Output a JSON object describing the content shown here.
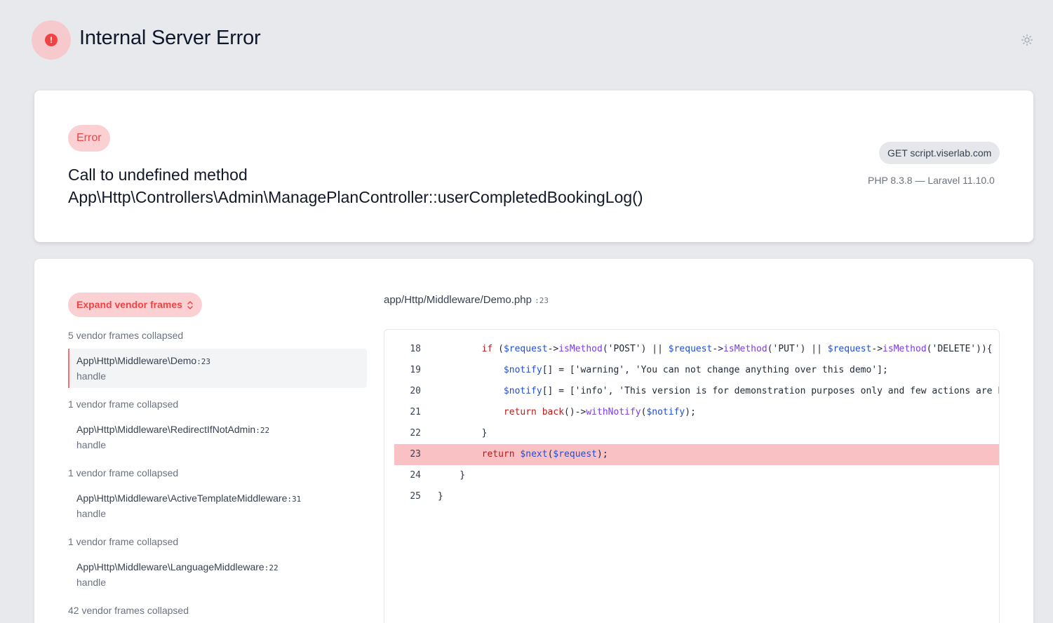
{
  "header": {
    "title": "Internal Server Error",
    "icon": "exclamation-circle-icon",
    "theme_icon": "sun-icon"
  },
  "summary": {
    "badge": "Error",
    "message_line1": "Call to undefined method",
    "message_line2": "App\\Http\\Controllers\\Admin\\ManagePlanController::userCompletedBookingLog()",
    "request": "GET script.viserlab.com",
    "versions": "PHP 8.3.8 — Laravel 11.10.0"
  },
  "trace": {
    "expand_label": "Expand vendor frames",
    "groups": [
      {
        "collapsed": "5 vendor frames collapsed",
        "class": "App\\Http\\Middleware\\Demo",
        "line": ":23",
        "method": "handle",
        "active": true
      },
      {
        "collapsed": "1 vendor frame collapsed",
        "class": "App\\Http\\Middleware\\RedirectIfNotAdmin",
        "line": ":22",
        "method": "handle"
      },
      {
        "collapsed": "1 vendor frame collapsed",
        "class": "App\\Http\\Middleware\\ActiveTemplateMiddleware",
        "line": ":31",
        "method": "handle"
      },
      {
        "collapsed": "1 vendor frame collapsed",
        "class": "App\\Http\\Middleware\\LanguageMiddleware",
        "line": ":22",
        "method": "handle"
      }
    ],
    "tail_collapsed": "42 vendor frames collapsed",
    "file": "app/Http/Middleware/Demo.php",
    "file_line": ":23"
  },
  "code": {
    "highlight_line": 23,
    "lines": [
      {
        "n": "18",
        "text": "        if ($request->isMethod('POST') || $request->isMethod('PUT') || $request->isMethod('DELETE')){"
      },
      {
        "n": "19",
        "text": "            $notify[] = ['warning', 'You can not change anything over this demo'];"
      },
      {
        "n": "20",
        "text": "            $notify[] = ['info', 'This version is for demonstration purposes only and few actions are bl"
      },
      {
        "n": "21",
        "text": "            return back()->withNotify($notify);"
      },
      {
        "n": "22",
        "text": "        }"
      },
      {
        "n": "23",
        "text": "        return $next($request);"
      },
      {
        "n": "24",
        "text": "    }"
      },
      {
        "n": "25",
        "text": "}"
      }
    ]
  },
  "colors": {
    "accent": "#ef4444",
    "accent_soft": "#fbd0d3",
    "highlight": "#f9c1c3",
    "background": "#e8e9ed"
  }
}
